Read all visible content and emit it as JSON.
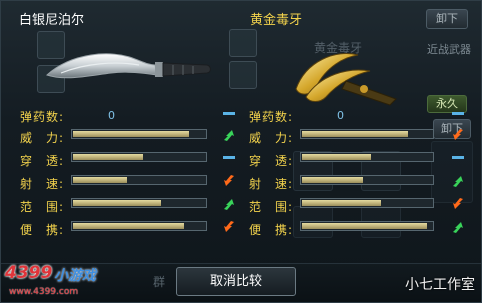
{
  "colors": {
    "label_gold": "#f2d24c",
    "value_blue": "#7fc1e6",
    "up_green": "#39d35a",
    "down_orange": "#ff6a1a",
    "equal_blue": "#5ab3e6"
  },
  "left_weapon": {
    "name": "白银尼泊尔",
    "ammo_value": "0"
  },
  "right_weapon": {
    "name": "黄金毒牙",
    "ammo_value": "0",
    "unload_label": "卸下",
    "category_label": "近战武器",
    "duration_badge": "永久",
    "unload_label_2": "卸下",
    "ghost_name": "黄金毒牙"
  },
  "stats": {
    "ammo_label": "弹药数:",
    "power_label": "威　力:",
    "penetration_label": "穿　透:",
    "rate_label": "射　速:",
    "range_label": "范　围:",
    "portability_label": "便　携:"
  },
  "left_bars": {
    "power": 0.88,
    "penetration": 0.54,
    "rate": 0.42,
    "range": 0.67,
    "portability": 0.84
  },
  "right_bars": {
    "power": 0.82,
    "penetration": 0.54,
    "rate": 0.48,
    "range": 0.61,
    "portability": 0.96
  },
  "left_indicators": {
    "ammo": "equal-icon",
    "power": "arrow-up-icon",
    "penetration": "equal-icon",
    "rate": "arrow-down-icon",
    "range": "arrow-up-icon",
    "portability": "arrow-down-icon"
  },
  "right_indicators": {
    "ammo": "equal-icon",
    "power": "arrow-down-icon",
    "penetration": "equal-icon",
    "rate": "arrow-up-icon",
    "range": "arrow-down-icon",
    "portability": "arrow-up-icon"
  },
  "bottom": {
    "cancel_label": "取消比较",
    "ghost_left": "群",
    "logo_main": "4399",
    "logo_sub": "小游戏",
    "logo_url": "www.4399.com",
    "watermark": "小七工作室"
  }
}
